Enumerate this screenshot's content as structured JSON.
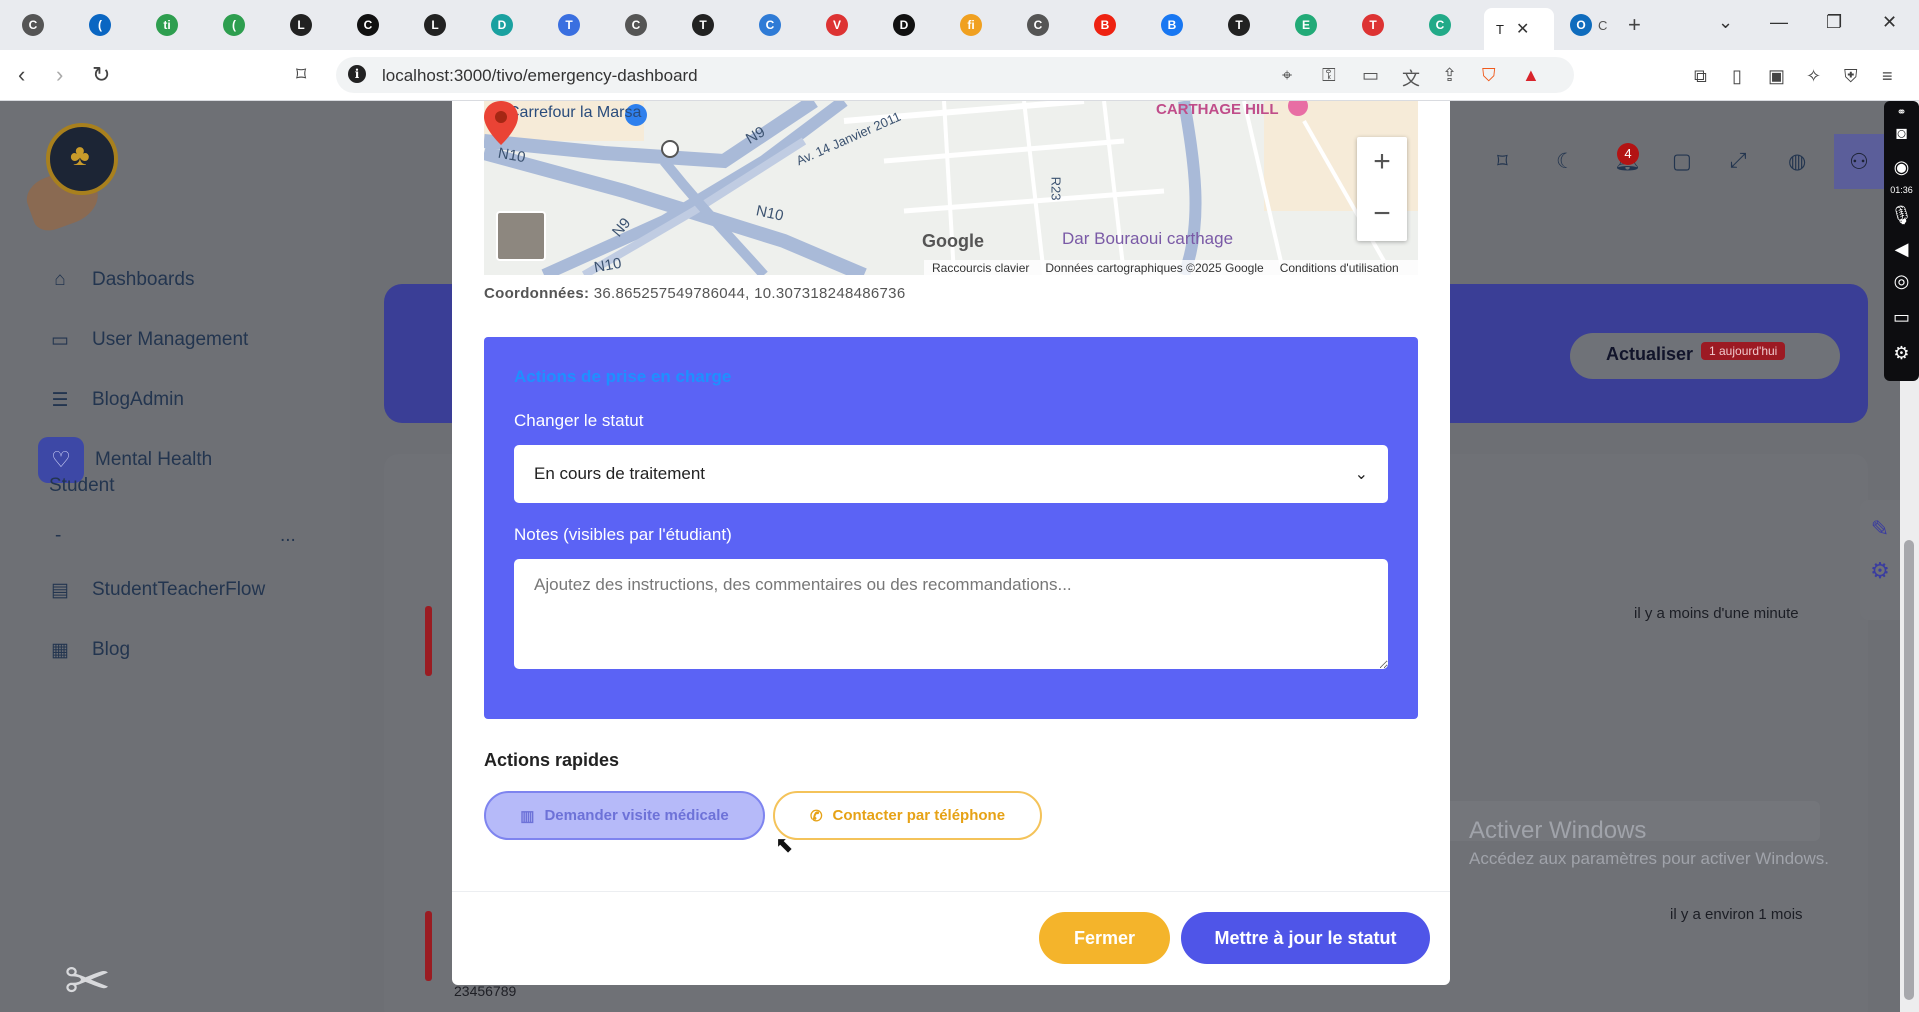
{
  "browser": {
    "tabs": [
      {
        "letter": "C",
        "color": "#555"
      },
      {
        "letter": "(",
        "color": "#0a66c2"
      },
      {
        "letter": "ti",
        "color": "#2e9e4f"
      },
      {
        "letter": "(",
        "color": "#2e9e4f"
      },
      {
        "letter": "L",
        "color": "#222"
      },
      {
        "letter": "C",
        "color": "#111"
      },
      {
        "letter": "L",
        "color": "#222"
      },
      {
        "letter": "D",
        "color": "#1aa1a0"
      },
      {
        "letter": "T",
        "color": "#3a6fe0"
      },
      {
        "letter": "C",
        "color": "#555"
      },
      {
        "letter": "T",
        "color": "#222"
      },
      {
        "letter": "C",
        "color": "#2f7bd6"
      },
      {
        "letter": "V",
        "color": "#d33"
      },
      {
        "letter": "D",
        "color": "#111"
      },
      {
        "letter": "fi",
        "color": "#f0a020"
      },
      {
        "letter": "C",
        "color": "#555"
      },
      {
        "letter": "B",
        "color": "#e21"
      },
      {
        "letter": "B",
        "color": "#1877f2"
      },
      {
        "letter": "T",
        "color": "#222"
      },
      {
        "letter": "E",
        "color": "#2a7"
      },
      {
        "letter": "T",
        "color": "#d33"
      },
      {
        "letter": "C",
        "color": "#2a8"
      }
    ],
    "active_tab_label": "T",
    "last_tab_letter": "C",
    "url": "localhost:3000/tivo/emergency-dashboard"
  },
  "sidebar": {
    "items": [
      {
        "label": "Dashboards",
        "icon": "home-icon"
      },
      {
        "label": "User Management",
        "icon": "monitor-icon"
      },
      {
        "label": "BlogAdmin",
        "icon": "server-icon"
      },
      {
        "label": "Mental Health",
        "icon": "heart-icon"
      },
      {
        "label": "StudentTeacherFlow",
        "icon": "calendar-icon"
      },
      {
        "label": "Blog",
        "icon": "grid-icon"
      }
    ],
    "mental_health_sub": "Student",
    "divider_left": "-",
    "divider_right": "..."
  },
  "topbar": {
    "notification_count": "4"
  },
  "background": {
    "refresh_label": "Actualiser",
    "today_badge": "1 aujourd'hui",
    "time_recent": "il y a moins d'une minute",
    "time_old": "il y a environ 1 mois",
    "phone": "23456789",
    "windows_title": "Activer Windows",
    "windows_sub": "Accédez aux paramètres pour activer Windows.",
    "recorder_time": "01:36"
  },
  "map": {
    "labels": {
      "carrefour": "Carrefour la Marsa",
      "carthage_hill": "CARTHAGE HILL",
      "dar_bouraoui": "Dar Bouraoui carthage",
      "n10_a": "N10",
      "n10_b": "N10",
      "n10_c": "N10",
      "n9_a": "N9",
      "n9_b": "N9",
      "av14": "Av. 14 Janvier 2011",
      "r23": "R23"
    },
    "google": "Google",
    "footer": [
      "Raccourcis clavier",
      "Données cartographiques ©2025 Google",
      "Conditions d'utilisation"
    ],
    "zoom_in": "+",
    "zoom_out": "−"
  },
  "modal": {
    "coords_label": "Coordonnées:",
    "coords_value": "36.865257549786044, 10.307318248486736",
    "panel_title": "Actions de prise en charge",
    "status_label": "Changer le statut",
    "status_value": "En cours de traitement",
    "notes_label": "Notes (visibles par l'étudiant)",
    "notes_placeholder": "Ajoutez des instructions, des commentaires ou des recommandations...",
    "quick_title": "Actions rapides",
    "quick_medical": "Demander visite médicale",
    "quick_phone": "Contacter par téléphone",
    "close_label": "Fermer",
    "update_label": "Mettre à jour le statut"
  },
  "colors": {
    "accent": "#5b63f5",
    "primary_button": "#4f55e8",
    "close_button": "#f4b42b"
  }
}
